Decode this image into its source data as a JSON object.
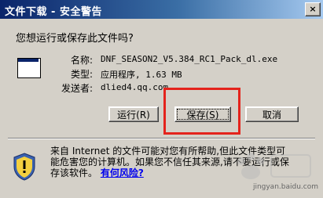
{
  "window": {
    "title": "文件下载 - 安全警告",
    "close_symbol": "×"
  },
  "question": "您想运行或保存此文件吗?",
  "file": {
    "icon": "application-window-icon",
    "name_label": "名称:",
    "name_value": "DNF_SEASON2_V5.384_RC1_Pack_dl.exe",
    "type_label": "类型:",
    "type_value": "应用程序, 1.63 MB",
    "publisher_label": "发送者:",
    "publisher_value": "dlied4.qq.com"
  },
  "buttons": {
    "run": "运行(R)",
    "save": "保存(S)",
    "cancel": "取消"
  },
  "warning": {
    "icon": "shield-warning-icon",
    "text": "来自 Internet 的文件可能对您有所帮助,但此文件类型可能危害您的计算机。如果您不信任其来源,请不要运行或保存该软件。",
    "link": "有何风险?"
  },
  "watermark": {
    "site": "jingyan.baidu.com"
  },
  "colors": {
    "highlight": "#e4231c",
    "titlebar": "#0a246a",
    "face": "#d4d0c8"
  }
}
